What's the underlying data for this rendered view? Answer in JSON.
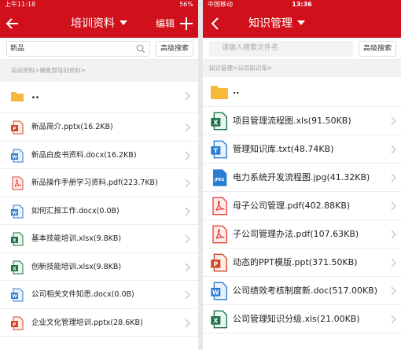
{
  "left": {
    "status": {
      "left": "上午11:18",
      "right": "56%"
    },
    "nav": {
      "title": "培训资料",
      "edit_label": "编辑"
    },
    "search": {
      "value": "新品",
      "advanced_label": "高级搜索"
    },
    "breadcrumb": "培训资料>销售部培训资料>",
    "folder_label": "..",
    "files": [
      {
        "name": "新品简介.pptx(16.2KB)",
        "icon": "ppt-icon"
      },
      {
        "name": "新品白皮书资料.docx(16.2KB)",
        "icon": "word-icon"
      },
      {
        "name": "新品操作手册学习资料.pdf(223.7KB)",
        "icon": "pdf-icon"
      },
      {
        "name": "如何汇报工作.docx(0.0B)",
        "icon": "word-icon"
      },
      {
        "name": "基本技能培训.xlsx(9.8KB)",
        "icon": "excel-icon"
      },
      {
        "name": "创新技能培训.xlsx(9.8KB)",
        "icon": "excel-icon"
      },
      {
        "name": "公司相关文件知悉.docx(0.0B)",
        "icon": "word-icon"
      },
      {
        "name": "企业文化管理培训.pptx(28.6KB)",
        "icon": "ppt-icon"
      }
    ]
  },
  "right": {
    "status": {
      "left": "中国移动",
      "center": "13:36"
    },
    "nav": {
      "title": "知识管理"
    },
    "search": {
      "placeholder": "请输入搜索文件名",
      "advanced_label": "高级搜索"
    },
    "breadcrumb": "知识管理>公司知识库>",
    "folder_label": "..",
    "files": [
      {
        "name": "项目管理流程图.xls(91.50KB)",
        "icon": "excel-icon"
      },
      {
        "name": "管理知识库.txt(48.74KB)",
        "icon": "txt-icon"
      },
      {
        "name": "电力系统开发流程图.jpg(41.32KB)",
        "icon": "jpeg-icon"
      },
      {
        "name": "母子公司管理.pdf(402.88KB)",
        "icon": "pdf-icon"
      },
      {
        "name": "子公司管理办法.pdf(107.63KB)",
        "icon": "pdf-icon"
      },
      {
        "name": "动态的PPT模版.ppt(371.50KB)",
        "icon": "ppt-icon"
      },
      {
        "name": "公司绩效考核制度新.doc(517.00KB)",
        "icon": "word-icon"
      },
      {
        "name": "公司管理知识分级.xls(21.00KB)",
        "icon": "excel-icon"
      }
    ]
  },
  "colors": {
    "brand_red": "#d0101b",
    "word_blue": "#2b7cd3",
    "excel_green": "#1e7145",
    "pdf_red": "#e8423a",
    "ppt_orange": "#d24625",
    "folder_yellow": "#f6b93b"
  }
}
